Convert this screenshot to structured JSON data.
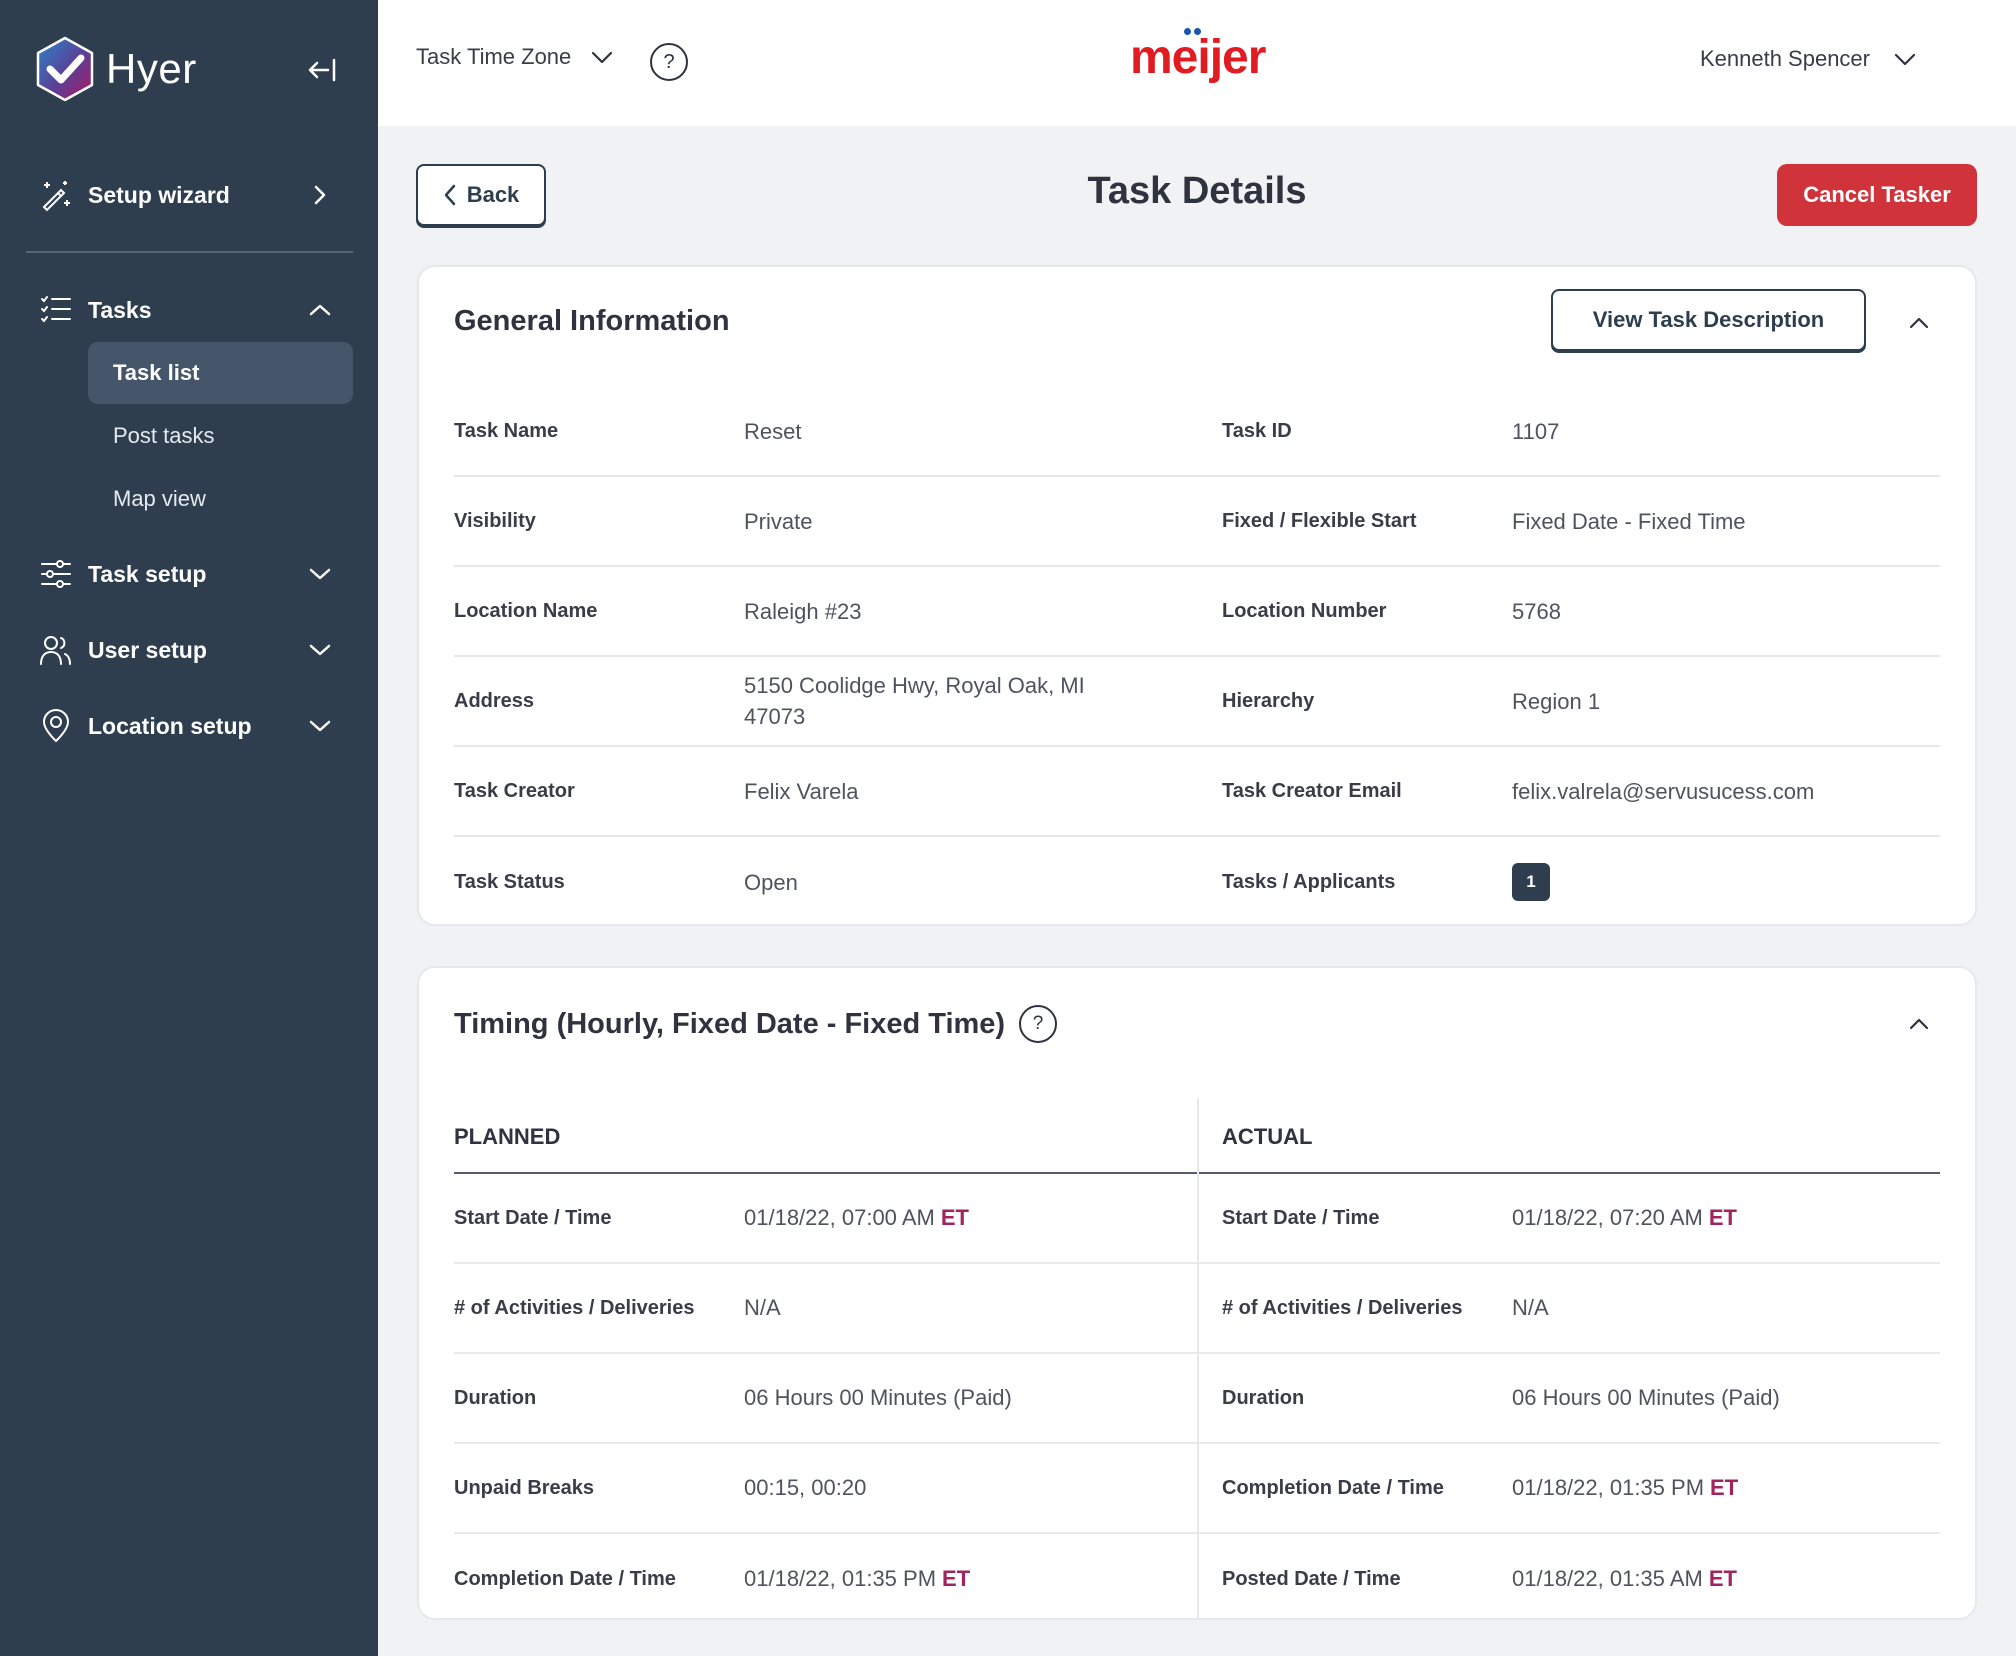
{
  "app": {
    "name": "Hyer",
    "brand_colors": {
      "sidebar_bg": "#2e3e4f",
      "danger": "#d0343a",
      "timezone_accent": "#a0245f",
      "client_logo_red": "#e11b22",
      "client_logo_blue": "#1b57a6"
    }
  },
  "sidebar": {
    "collapse_icon": "collapse-left-icon",
    "items": [
      {
        "label": "Setup wizard",
        "icon": "magic-wand-icon",
        "chevron": "chevron-right-icon"
      },
      {
        "label": "Tasks",
        "icon": "checklist-icon",
        "chevron": "chevron-up-icon",
        "expanded": true,
        "children": [
          {
            "label": "Task list",
            "active": true
          },
          {
            "label": "Post tasks",
            "active": false
          },
          {
            "label": "Map view",
            "active": false
          }
        ]
      },
      {
        "label": "Task setup",
        "icon": "sliders-icon",
        "chevron": "chevron-down-icon"
      },
      {
        "label": "User setup",
        "icon": "users-icon",
        "chevron": "chevron-down-icon"
      },
      {
        "label": "Location setup",
        "icon": "location-pin-icon",
        "chevron": "chevron-down-icon"
      }
    ]
  },
  "header": {
    "timezone_label": "Task Time Zone",
    "help_icon": "?",
    "client_logo": "meijer",
    "user_name": "Kenneth Spencer"
  },
  "page": {
    "back_label": "Back",
    "title": "Task Details",
    "cancel_label": "Cancel Tasker"
  },
  "general": {
    "title": "General Information",
    "view_description_label": "View Task Description",
    "rows": [
      {
        "left": {
          "label": "Task Name",
          "value": "Reset"
        },
        "right": {
          "label": "Task ID",
          "value": "1107"
        }
      },
      {
        "left": {
          "label": "Visibility",
          "value": "Private"
        },
        "right": {
          "label": "Fixed / Flexible Start",
          "value": "Fixed Date - Fixed Time"
        }
      },
      {
        "left": {
          "label": "Location Name",
          "value": "Raleigh #23"
        },
        "right": {
          "label": "Location Number",
          "value": "5768"
        }
      },
      {
        "left": {
          "label": "Address",
          "value": "5150 Coolidge Hwy, Royal Oak, MI 47073"
        },
        "right": {
          "label": "Hierarchy",
          "value": "Region 1"
        }
      },
      {
        "left": {
          "label": "Task Creator",
          "value": "Felix Varela"
        },
        "right": {
          "label": "Task Creator Email",
          "value": "felix.valrela@servusucess.com"
        }
      },
      {
        "left": {
          "label": "Task Status",
          "value": "Open"
        },
        "right": {
          "label": "Tasks / Applicants",
          "value": "1"
        }
      }
    ]
  },
  "timing": {
    "title": "Timing (Hourly, Fixed Date - Fixed Time)",
    "help_icon": "?",
    "planned": {
      "heading": "PLANNED",
      "rows": [
        {
          "label": "Start Date / Time",
          "value": "01/18/22, 07:00 AM",
          "tz": "ET"
        },
        {
          "label": "# of Activities / Deliveries",
          "value": "N/A",
          "tz": ""
        },
        {
          "label": "Duration",
          "value": "06 Hours 00 Minutes (Paid)",
          "tz": ""
        },
        {
          "label": "Unpaid Breaks",
          "value": "00:15, 00:20",
          "tz": ""
        },
        {
          "label": "Completion Date / Time",
          "value": "01/18/22, 01:35 PM",
          "tz": "ET"
        }
      ]
    },
    "actual": {
      "heading": "ACTUAL",
      "rows": [
        {
          "label": "Start Date / Time",
          "value": "01/18/22, 07:20 AM",
          "tz": "ET"
        },
        {
          "label": "# of Activities / Deliveries",
          "value": "N/A",
          "tz": ""
        },
        {
          "label": "Duration",
          "value": "06 Hours 00 Minutes (Paid)",
          "tz": ""
        },
        {
          "label": "Completion Date / Time",
          "value": "01/18/22, 01:35 PM",
          "tz": "ET"
        },
        {
          "label": "Posted Date / Time",
          "value": "01/18/22, 01:35 AM",
          "tz": "ET"
        }
      ]
    }
  }
}
